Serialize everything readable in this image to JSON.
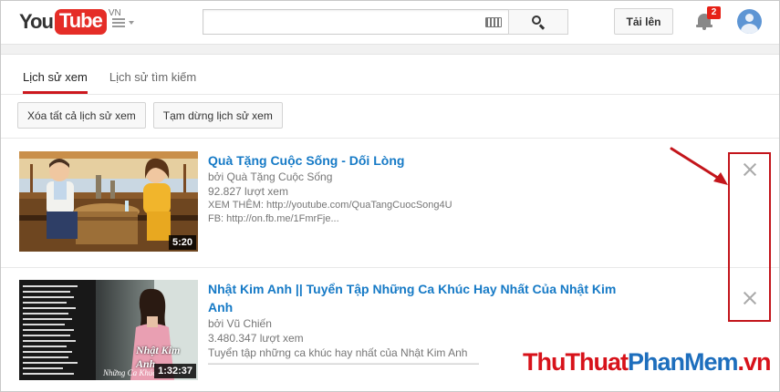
{
  "header": {
    "logo_you": "You",
    "logo_tube": "Tube",
    "logo_region": "VN",
    "search_placeholder": "",
    "upload_label": "Tải lên",
    "notification_count": "2"
  },
  "tabs": [
    {
      "label": "Lịch sử xem",
      "active": true
    },
    {
      "label": "Lịch sử tìm kiếm",
      "active": false
    }
  ],
  "actions": {
    "clear_all": "Xóa tất cả lịch sử xem",
    "pause": "Tạm dừng lịch sử xem"
  },
  "videos": [
    {
      "title": "Quà Tặng Cuộc Sống - Dối Lòng",
      "channel": "bởi Quà Tặng Cuộc Sống",
      "views": "92.827 lượt xem",
      "desc_1": "XEM THÊM: http://youtube.com/QuaTangCuocSong4U",
      "desc_2": "FB: http://on.fb.me/1FmrFje...",
      "duration": "5:20"
    },
    {
      "title": "Nhật Kim Anh || Tuyển Tập Những Ca Khúc Hay Nhất Của Nhật Kim Anh",
      "channel": "bởi Vũ Chiến",
      "views": "3.480.347 lượt xem",
      "desc_1": "Tuyển tập những ca khúc hay nhất của Nhật Kim Anh",
      "desc_2": "———————————————————————————",
      "duration": "1:32:37",
      "thumb_caption": "Nhật Kim Anh",
      "thumb_subcaption": "Những Ca Khúc"
    }
  ],
  "watermark": {
    "part1": "ThuThuat",
    "part2": "PhanMem",
    "part3": ".vn"
  },
  "colors": {
    "brand_red": "#e52d27",
    "link_blue": "#167ac6",
    "annotation_red": "#c3151b"
  }
}
